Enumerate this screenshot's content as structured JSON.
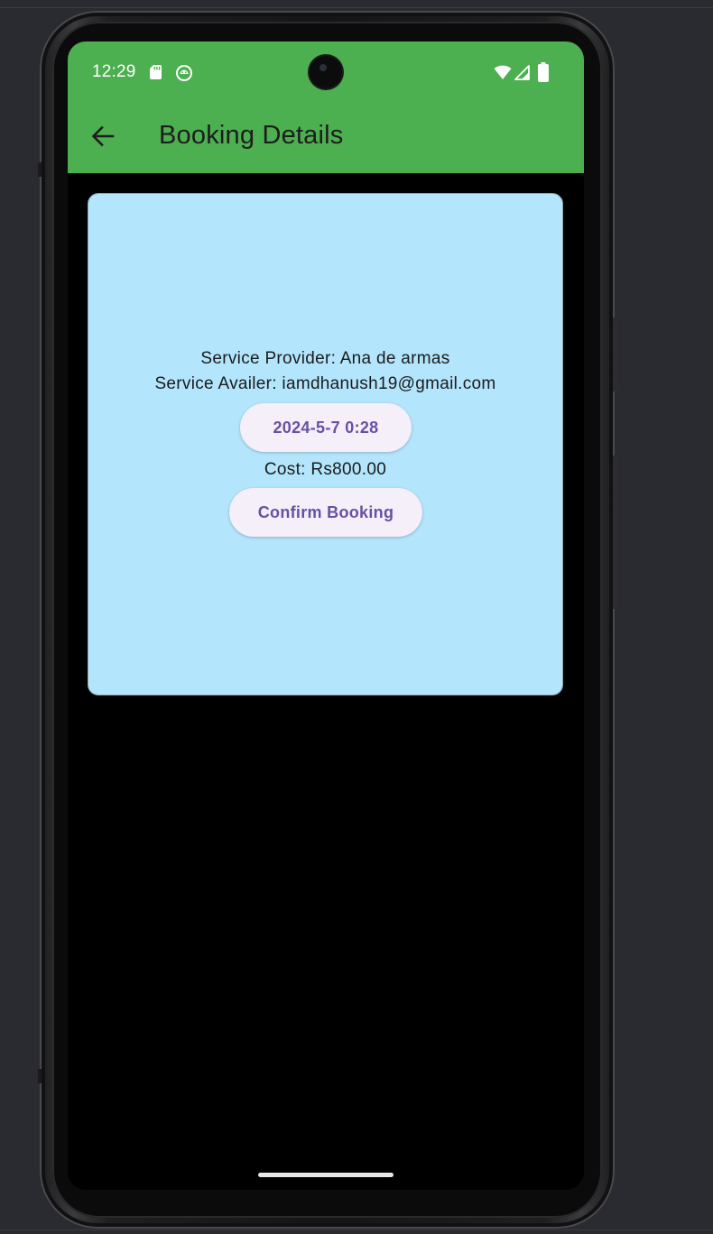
{
  "status_bar": {
    "time": "12:29",
    "left_icons": [
      "sd-card-icon",
      "android-debug-icon"
    ],
    "right_icons": [
      "wifi-icon",
      "cell-signal-icon",
      "battery-icon"
    ]
  },
  "app_bar": {
    "back_icon": "arrow-left-icon",
    "title": "Booking Details",
    "background_color": "#4caf50"
  },
  "card": {
    "background_color": "#b3e5fc",
    "service_provider": "Service Provider: Ana de armas",
    "service_availer": "Service Availer: iamdhanush19@gmail.com",
    "date_button_label": "2024-5-7 0:28",
    "cost": "Cost: Rs800.00",
    "confirm_button_label": "Confirm Booking",
    "button_text_color": "#6750a4"
  }
}
